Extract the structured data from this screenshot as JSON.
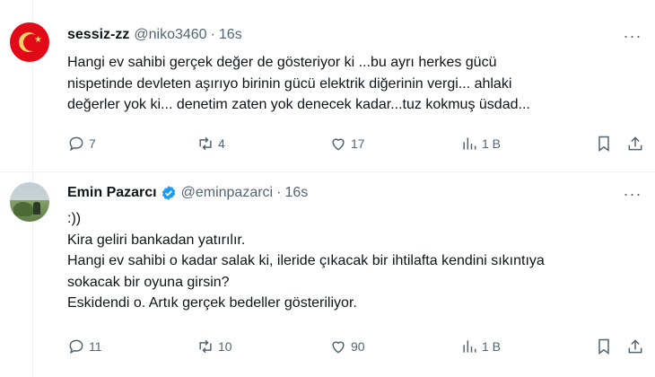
{
  "posts": [
    {
      "author_name": "sessiz-zz",
      "handle": "@niko3460",
      "separator": "·",
      "time": "16s",
      "verified": false,
      "avatar": "turkish-flag-avatar",
      "text_lines": [
        "Hangi ev sahibi gerçek değer de gösteriyor ki ...bu ayrı herkes gücü",
        "nispetinde devleten aşırıyo birinin gücü elektrik diğerinin vergi... ahlaki",
        "değerler yok ki... denetim zaten yok denecek kadar...tuz kokmuş üsdad..."
      ],
      "replies": "7",
      "reposts": "4",
      "likes": "17",
      "views": "1 B",
      "more_label": "···"
    },
    {
      "author_name": "Emin Pazarcı",
      "handle": "@eminpazarci",
      "separator": "·",
      "time": "16s",
      "verified": true,
      "avatar": "landscape-photo-avatar",
      "text_lines": [
        ":))",
        "Kira geliri bankadan yatırılır.",
        "Hangi ev sahibi o kadar salak ki, ileride çıkacak bir ihtilafta kendini sıkıntıya",
        "sokacak bir oyuna girsin?",
        "Eskidendi o. Artık gerçek bedeller gösteriliyor."
      ],
      "replies": "11",
      "reposts": "10",
      "likes": "90",
      "views": "1 B",
      "more_label": "···"
    }
  ],
  "colors": {
    "text": "#0f1419",
    "secondary": "#536471",
    "verified_blue": "#1d9bf0",
    "divider": "#eff3f4"
  },
  "icons": [
    "reply-icon",
    "repost-icon",
    "like-icon",
    "views-icon",
    "bookmark-icon",
    "share-icon",
    "more-icon",
    "verified-badge-icon"
  ]
}
